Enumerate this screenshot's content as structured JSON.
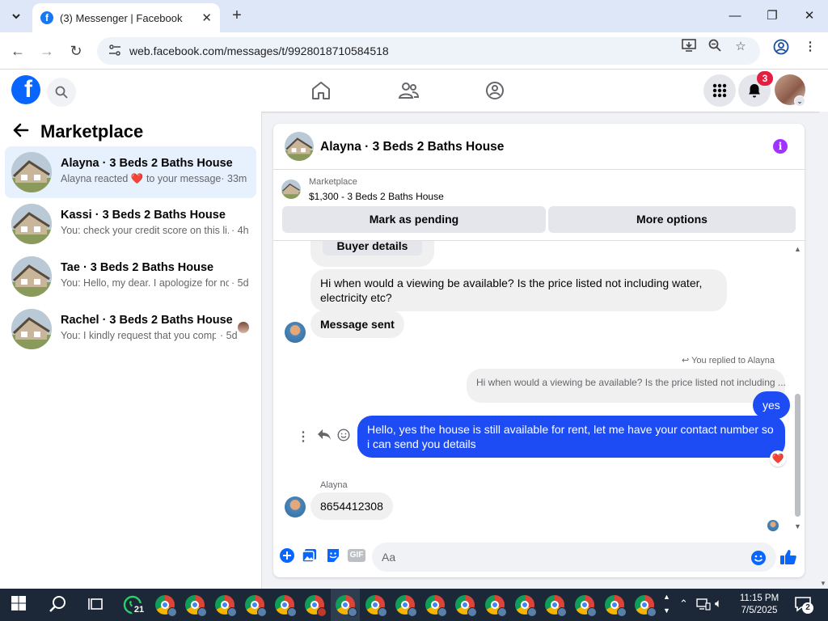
{
  "browser": {
    "tab_title": "(3) Messenger | Facebook",
    "url": "web.facebook.com/messages/t/9928018710584518",
    "tab_close": "✕",
    "newtab": "+"
  },
  "fb": {
    "notification_count": "3"
  },
  "sidebar": {
    "title": "Marketplace",
    "conversations": [
      {
        "name": "Alayna · 3 Beds 2 Baths House",
        "preview_a": "Alayna reacted",
        "preview_b": "to your message",
        "time": "· 33m",
        "active": true
      },
      {
        "name": "Kassi · 3 Beds 2 Baths House",
        "preview": "You: check your credit score on this li...",
        "time": "· 4h"
      },
      {
        "name": "Tae · 3 Beds 2 Baths House",
        "preview": "You: Hello, my dear. I apologize for no...",
        "time": "· 5d"
      },
      {
        "name": "Rachel · 3 Beds 2 Baths House",
        "preview": "You: I kindly request that you comp...",
        "time": "· 5d"
      }
    ]
  },
  "chat": {
    "title": "Alayna · 3 Beds 2 Baths House",
    "listing_source": "Marketplace",
    "listing_price_title": "$1,300 - 3 Beds 2 Baths House",
    "mark_pending_label": "Mark as pending",
    "more_options_label": "More options",
    "messages": {
      "buyer_details_label": "Buyer details",
      "incoming_question": "Hi when would a viewing be available? Is the price listed not including water, electricity etc?",
      "message_sent": "Message sent",
      "replied_to_label": "You replied to Alayna",
      "quoted_reply": "Hi when would a viewing be available? Is the price listed not including ...",
      "out_yes": "yes",
      "out_reply": "Hello, yes the house is still available for rent, let me have your contact number so i can send you  details",
      "sender_label": "Alayna",
      "incoming_number": "8654412308"
    },
    "composer_placeholder": "Aa",
    "gif_label": "GIF"
  },
  "taskbar": {
    "whatsapp_badge": "21",
    "time": "11:15 PM",
    "date": "7/5/2025",
    "notif_count": "2"
  },
  "colors": {
    "fb_blue": "#0866ff",
    "outgoing_bubble": "#1d4cf5",
    "info_purple": "#a033ff",
    "badge_red": "#e41e3f"
  }
}
